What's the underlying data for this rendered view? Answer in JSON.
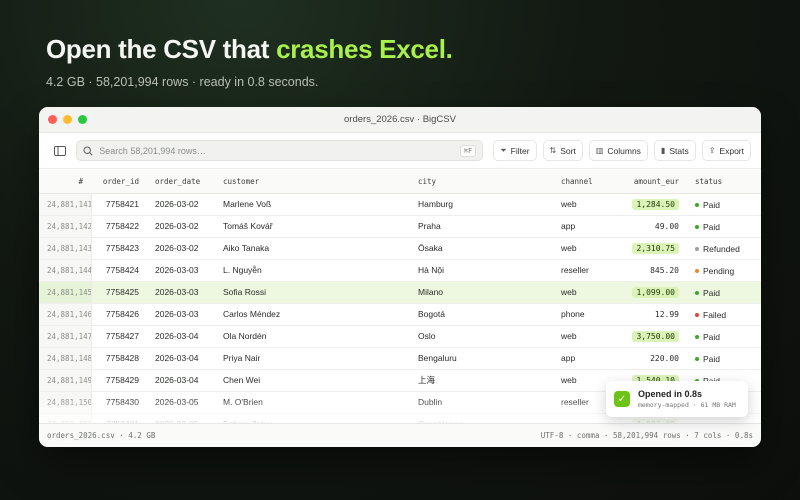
{
  "hero": {
    "headline_plain": "Open the CSV that ",
    "headline_accent": "crashes Excel.",
    "subline": "4.2 GB · 58,201,994 rows · ready in 0.8 seconds."
  },
  "window": {
    "title": "orders_2026.csv · BigCSV",
    "search_placeholder": "Search 58,201,994 rows…",
    "search_shortcut": "⌘F",
    "toolbar": {
      "filter_label": "Filter",
      "sort_label": "Sort",
      "columns_label": "Columns",
      "stats_label": "Stats",
      "export_label": "Export"
    }
  },
  "table": {
    "columns": [
      "#",
      "order_id",
      "order_date",
      "customer",
      "city",
      "channel",
      "amount_eur",
      "status"
    ],
    "rows": [
      {
        "rownum": "24,881,141",
        "order_id": "7758421",
        "order_date": "2026-03-02",
        "customer": "Marlene Voß",
        "city": "Hamburg",
        "channel": "web",
        "amount": "1,284.50",
        "amount_hl": true,
        "status": "Paid"
      },
      {
        "rownum": "24,881,142",
        "order_id": "7758422",
        "order_date": "2026-03-02",
        "customer": "Tomáš Kovář",
        "city": "Praha",
        "channel": "app",
        "amount": "49.00",
        "amount_hl": false,
        "status": "Paid"
      },
      {
        "rownum": "24,881,143",
        "order_id": "7758423",
        "order_date": "2026-03-02",
        "customer": "Aiko Tanaka",
        "city": "Ōsaka",
        "channel": "web",
        "amount": "2,310.75",
        "amount_hl": true,
        "status": "Refunded"
      },
      {
        "rownum": "24,881,144",
        "order_id": "7758424",
        "order_date": "2026-03-03",
        "customer": "L. Nguyễn",
        "city": "Hà Nội",
        "channel": "reseller",
        "amount": "845.20",
        "amount_hl": false,
        "status": "Pending"
      },
      {
        "rownum": "24,881,145",
        "order_id": "7758425",
        "order_date": "2026-03-03",
        "customer": "Sofia Rossi",
        "city": "Milano",
        "channel": "web",
        "amount": "1,099.00",
        "amount_hl": true,
        "status": "Paid",
        "highlighted": true
      },
      {
        "rownum": "24,881,146",
        "order_id": "7758426",
        "order_date": "2026-03-03",
        "customer": "Carlos Méndez",
        "city": "Bogotá",
        "channel": "phone",
        "amount": "12.99",
        "amount_hl": false,
        "status": "Failed"
      },
      {
        "rownum": "24,881,147",
        "order_id": "7758427",
        "order_date": "2026-03-04",
        "customer": "Ola Nordén",
        "city": "Oslo",
        "channel": "web",
        "amount": "3,750.00",
        "amount_hl": true,
        "status": "Paid"
      },
      {
        "rownum": "24,881,148",
        "order_id": "7758428",
        "order_date": "2026-03-04",
        "customer": "Priya Nair",
        "city": "Bengaluru",
        "channel": "app",
        "amount": "220.00",
        "amount_hl": false,
        "status": "Paid"
      },
      {
        "rownum": "24,881,149",
        "order_id": "7758429",
        "order_date": "2026-03-04",
        "customer": "Chen Wei",
        "city": "上海",
        "channel": "web",
        "amount": "1,540.10",
        "amount_hl": true,
        "status": "Paid"
      },
      {
        "rownum": "24,881,150",
        "order_id": "7758430",
        "order_date": "2026-03-05",
        "customer": "M. O'Brien",
        "city": "Dublin",
        "channel": "reseller",
        "amount": "",
        "amount_hl": false,
        "status": ""
      },
      {
        "rownum": "24,881,151",
        "order_id": "7758431",
        "order_date": "2026-03-05",
        "customer": "Fatima Zahra",
        "city": "Casablanca",
        "channel": "",
        "amount": "1,002.00",
        "amount_hl": true,
        "status": ""
      }
    ]
  },
  "status_colors": {
    "Paid": "#3fa82a",
    "Refunded": "#9a9d98",
    "Pending": "#e8892a",
    "Failed": "#e0443a"
  },
  "statusbar": {
    "left": "orders_2026.csv · 4.2 GB",
    "right": "UTF-8 · comma · 58,201,994 rows · 7 cols · 0.8s"
  },
  "toast": {
    "title": "Opened in 0.8s",
    "detail": "memory-mapped · 61 MB RAM"
  }
}
